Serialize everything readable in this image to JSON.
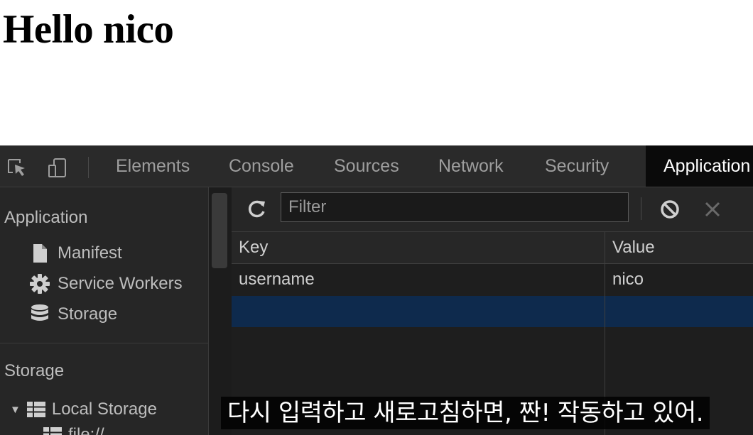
{
  "page": {
    "heading": "Hello nico"
  },
  "devtools": {
    "tabs": [
      {
        "label": "Elements",
        "active": false
      },
      {
        "label": "Console",
        "active": false
      },
      {
        "label": "Sources",
        "active": false
      },
      {
        "label": "Network",
        "active": false
      },
      {
        "label": "Security",
        "active": false
      },
      {
        "label": "Application",
        "active": true
      }
    ],
    "sidebar": {
      "application_section": "Application",
      "application_items": [
        {
          "label": "Manifest",
          "icon": "document-icon"
        },
        {
          "label": "Service Workers",
          "icon": "gear-icon"
        },
        {
          "label": "Storage",
          "icon": "database-icon"
        }
      ],
      "storage_section": "Storage",
      "storage_items": [
        {
          "label": "Local Storage",
          "icon": "grid-icon",
          "expanded": true
        },
        {
          "label": "file://",
          "icon": "grid-icon"
        }
      ]
    },
    "storage_view": {
      "filter_placeholder": "Filter",
      "filter_value": "",
      "columns": {
        "key": "Key",
        "value": "Value"
      },
      "rows": [
        {
          "key": "username",
          "value": "nico"
        },
        {
          "key": "",
          "value": ""
        }
      ]
    },
    "colors": {
      "panel_bg": "#242424",
      "active_tab_bg": "#0a0a0a",
      "selected_row": "#0e2a4d",
      "text": "#bdbdbd"
    }
  },
  "subtitle": {
    "text": "다시 입력하고 새로고침하면, 짠! 작동하고 있어."
  }
}
